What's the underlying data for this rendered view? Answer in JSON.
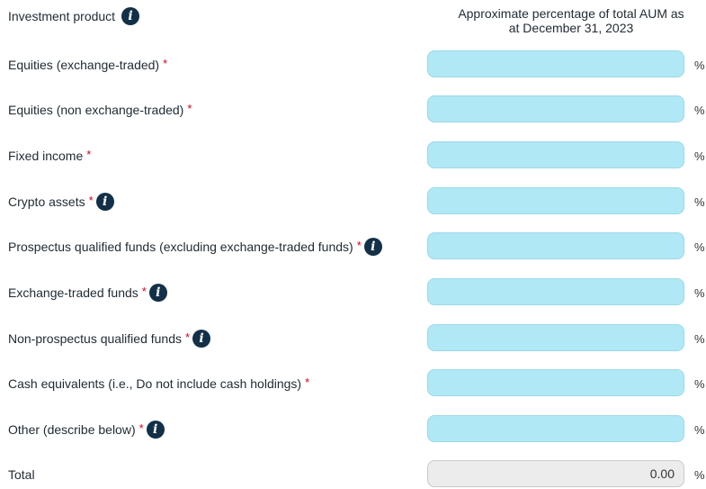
{
  "header": {
    "column_label": "Investment product",
    "value_column_line1": "Approximate percentage of total AUM as",
    "value_column_line2": "at December 31, 2023"
  },
  "unit": "%",
  "rows": [
    {
      "label": "Equities (exchange-traded)",
      "required": "*",
      "value": ""
    },
    {
      "label": "Equities (non exchange-traded)",
      "required": "*",
      "value": ""
    },
    {
      "label": "Fixed income",
      "required": "*",
      "value": ""
    },
    {
      "label": "Crypto assets",
      "required": "*",
      "value": ""
    },
    {
      "label": "Prospectus qualified funds (excluding exchange-traded funds)",
      "required": "*",
      "value": ""
    },
    {
      "label": "Exchange-traded funds",
      "required": "*",
      "value": ""
    },
    {
      "label": "Non-prospectus qualified funds",
      "required": "*",
      "value": ""
    },
    {
      "label": "Cash equivalents (i.e., Do not include cash holdings)",
      "required": "*",
      "value": ""
    },
    {
      "label": "Other (describe below)",
      "required": "*",
      "value": ""
    }
  ],
  "total": {
    "label": "Total",
    "value": "0.00"
  },
  "icons": {
    "info": "info-icon",
    "info_glyph": "i"
  },
  "colors": {
    "input_bg": "#b1e8f5",
    "total_bg": "#ececec",
    "required": "#d0021b",
    "info_icon_bg": "#123048"
  }
}
